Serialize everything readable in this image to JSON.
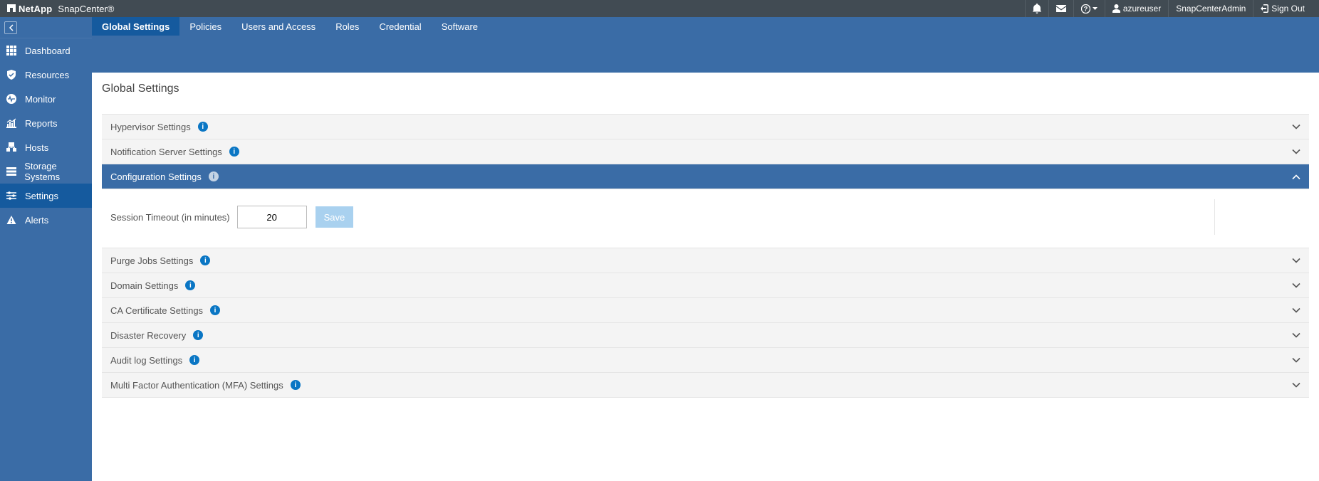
{
  "brand": {
    "company": "NetApp",
    "product": "SnapCenter®"
  },
  "topbar": {
    "user": "azureuser",
    "role": "SnapCenterAdmin",
    "signout": "Sign Out"
  },
  "sidebar": {
    "items": [
      {
        "label": "Dashboard"
      },
      {
        "label": "Resources"
      },
      {
        "label": "Monitor"
      },
      {
        "label": "Reports"
      },
      {
        "label": "Hosts"
      },
      {
        "label": "Storage Systems"
      },
      {
        "label": "Settings"
      },
      {
        "label": "Alerts"
      }
    ]
  },
  "tabs": [
    {
      "label": "Global Settings"
    },
    {
      "label": "Policies"
    },
    {
      "label": "Users and Access"
    },
    {
      "label": "Roles"
    },
    {
      "label": "Credential"
    },
    {
      "label": "Software"
    }
  ],
  "page": {
    "title": "Global Settings"
  },
  "sections": {
    "hypervisor": "Hypervisor Settings",
    "notification": "Notification Server Settings",
    "configuration": "Configuration Settings",
    "purge": "Purge Jobs Settings",
    "domain": "Domain Settings",
    "cacert": "CA Certificate Settings",
    "dr": "Disaster Recovery",
    "audit": "Audit log Settings",
    "mfa": "Multi Factor Authentication (MFA) Settings"
  },
  "config": {
    "session_label": "Session Timeout (in minutes)",
    "session_value": "20",
    "save_label": "Save"
  }
}
